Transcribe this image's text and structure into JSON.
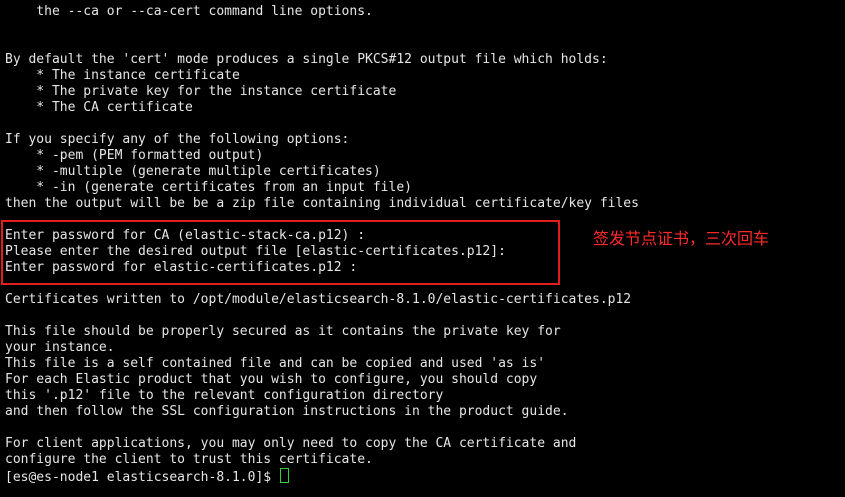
{
  "terminal": {
    "lines": [
      "    the --ca or --ca-cert command line options.",
      "",
      "",
      "By default the 'cert' mode produces a single PKCS#12 output file which holds:",
      "    * The instance certificate",
      "    * The private key for the instance certificate",
      "    * The CA certificate",
      "",
      "If you specify any of the following options:",
      "    * -pem (PEM formatted output)",
      "    * -multiple (generate multiple certificates)",
      "    * -in (generate certificates from an input file)",
      "then the output will be be a zip file containing individual certificate/key files",
      "",
      "Enter password for CA (elastic-stack-ca.p12) :",
      "Please enter the desired output file [elastic-certificates.p12]:",
      "Enter password for elastic-certificates.p12 :",
      "",
      "Certificates written to /opt/module/elasticsearch-8.1.0/elastic-certificates.p12",
      "",
      "This file should be properly secured as it contains the private key for",
      "your instance.",
      "This file is a self contained file and can be copied and used 'as is'",
      "For each Elastic product that you wish to configure, you should copy",
      "this '.p12' file to the relevant configuration directory",
      "and then follow the SSL configuration instructions in the product guide.",
      "",
      "For client applications, you may only need to copy the CA certificate and",
      "configure the client to trust this certificate."
    ],
    "prompt": "[es@es-node1 elasticsearch-8.1.0]$ "
  },
  "annotation": {
    "text": "签发节点证书，三次回车"
  },
  "colors": {
    "background": "#000000",
    "foreground": "#e6e6e6",
    "highlight_border": "#e01e1e",
    "annotation_text": "#ff2a2a",
    "cursor": "#32d232"
  }
}
